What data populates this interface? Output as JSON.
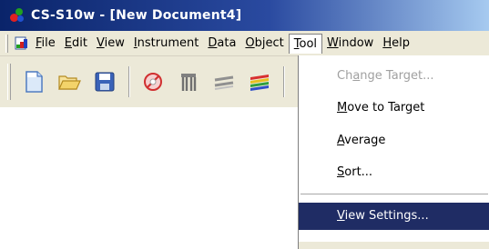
{
  "window": {
    "title": "CS-S10w - [New Document4]"
  },
  "menubar": {
    "items": [
      {
        "pre": "",
        "acc": "F",
        "post": "ile"
      },
      {
        "pre": "",
        "acc": "E",
        "post": "dit"
      },
      {
        "pre": "",
        "acc": "V",
        "post": "iew"
      },
      {
        "pre": "",
        "acc": "I",
        "post": "nstrument"
      },
      {
        "pre": "",
        "acc": "D",
        "post": "ata"
      },
      {
        "pre": "",
        "acc": "O",
        "post": "bject"
      },
      {
        "pre": "",
        "acc": "T",
        "post": "ool"
      },
      {
        "pre": "",
        "acc": "W",
        "post": "indow"
      },
      {
        "pre": "",
        "acc": "H",
        "post": "elp"
      }
    ]
  },
  "toolbar": {
    "buttons": [
      "new-document-icon",
      "open-folder-icon",
      "save-disk-icon",
      "measure-target-icon",
      "instrument-icon",
      "data-list-icon",
      "color-bars-icon"
    ]
  },
  "tool_menu": {
    "items": [
      {
        "pre": "Ch",
        "acc": "a",
        "post": "nge Target...",
        "enabled": false
      },
      {
        "pre": "",
        "acc": "M",
        "post": "ove to Target",
        "enabled": true
      },
      {
        "pre": "",
        "acc": "A",
        "post": "verage",
        "enabled": true
      },
      {
        "pre": "",
        "acc": "S",
        "post": "ort...",
        "enabled": true
      },
      {
        "pre": "",
        "acc": "V",
        "post": "iew Settings...",
        "enabled": true,
        "highlighted": true
      }
    ]
  },
  "colors": {
    "highlight": "#1f2c64",
    "titlebar": "#0a246a",
    "face": "#ece9d8"
  }
}
